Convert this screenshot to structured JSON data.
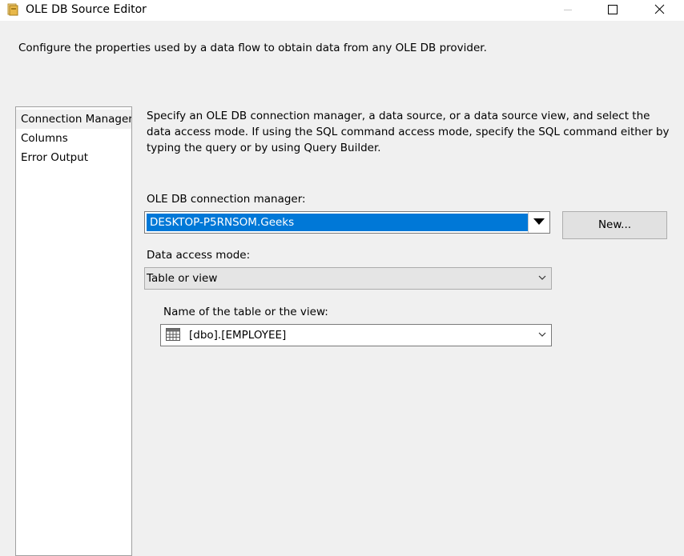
{
  "window": {
    "title": "OLE DB Source Editor",
    "icons": [
      "package-icon",
      "minimize-icon",
      "maximize-icon",
      "close-icon"
    ]
  },
  "header": {
    "description": "Configure the properties used by a data flow to obtain data from any OLE DB provider."
  },
  "nav": {
    "items": [
      {
        "label": "Connection Manager",
        "selected": true
      },
      {
        "label": "Columns",
        "selected": false
      },
      {
        "label": "Error Output",
        "selected": false
      }
    ]
  },
  "main": {
    "instructions": "Specify an OLE DB connection manager, a data source, or a data source view, and select the data access mode. If using the SQL command access mode, specify the SQL command either by typing the query or by using Query Builder.",
    "connection_manager": {
      "label": "OLE DB connection manager:",
      "value": "DESKTOP-P5RNSOM.Geeks",
      "new_button": "New..."
    },
    "access_mode": {
      "label": "Data access mode:",
      "value": "Table or view"
    },
    "table": {
      "label": "Name of the table or the view:",
      "value": "[dbo].[EMPLOYEE]"
    }
  },
  "colors": {
    "selection": "#0078d7",
    "background": "#f0f0f0",
    "button": "#e1e1e1"
  }
}
